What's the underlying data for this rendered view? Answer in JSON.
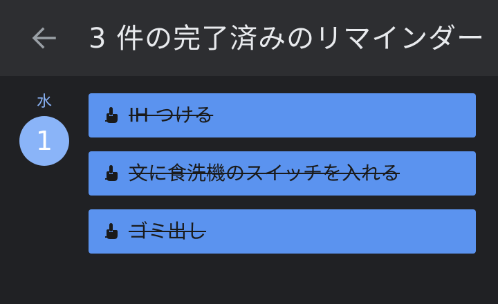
{
  "toolbar": {
    "title": "3 件の完了済みのリマインダー",
    "back_icon": "arrow-back-icon"
  },
  "day": {
    "weekday": "水",
    "date": "1"
  },
  "reminders": [
    {
      "label": "IH つける",
      "icon": "touch-gesture-icon",
      "done": true
    },
    {
      "label": "文に食洗機のスイッチを入れる",
      "icon": "touch-gesture-icon",
      "done": true
    },
    {
      "label": "ゴミ出し",
      "icon": "touch-gesture-icon",
      "done": true
    }
  ],
  "colors": {
    "background": "#202124",
    "toolbar": "#2d2e31",
    "accent": "#8ab4f8",
    "card": "#5b93ef"
  }
}
